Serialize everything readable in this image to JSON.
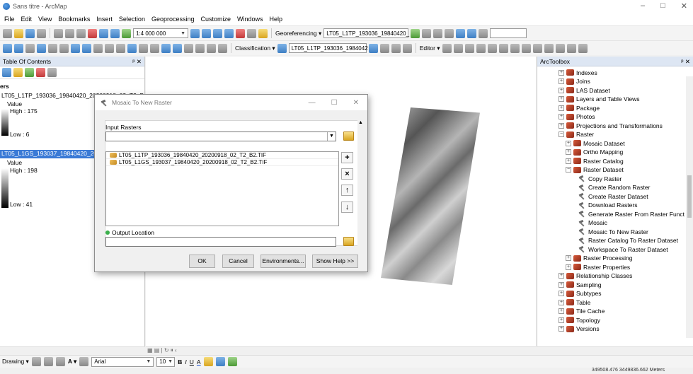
{
  "window": {
    "title": "Sans titre - ArcMap",
    "controls": [
      "–",
      "□",
      "✕"
    ]
  },
  "menu": [
    "File",
    "Edit",
    "View",
    "Bookmarks",
    "Insert",
    "Selection",
    "Geoprocessing",
    "Customize",
    "Windows",
    "Help"
  ],
  "toolbar1": {
    "scale": "1:4 000 000",
    "georef_label": "Georeferencing ▾",
    "georef_layer": "LT05_L1TP_193036_19840420_"
  },
  "toolbar2": {
    "classification_label": "Classification ▾",
    "layer": "LT05_L1TP_193036_1984042",
    "editor_label": "Editor ▾"
  },
  "toc": {
    "header": "Table Of Contents",
    "pin": "ᵖ ✕",
    "group": "ers",
    "layer1": {
      "name": "LT05_L1TP_193036_19840420_20200918_02_T2_B",
      "value_label": "Value",
      "high": "High : 175",
      "low": "Low : 6"
    },
    "layer2": {
      "name": "LT05_L1GS_193037_19840420_2020",
      "value_label": "Value",
      "high": "High : 198",
      "low": "Low : 41"
    }
  },
  "dialog": {
    "title": "Mosaic To New Raster",
    "input_label": "Input Rasters",
    "rasters": [
      "LT05_L1TP_193036_19840420_20200918_02_T2_B2.TIF",
      "LT05_L1GS_193037_19840420_20200918_02_T2_B2.TIF"
    ],
    "output_label": "Output Location",
    "buttons": {
      "ok": "OK",
      "cancel": "Cancel",
      "env": "Environments...",
      "help": "Show Help >>"
    },
    "side_buttons": [
      "+",
      "×",
      "↑",
      "↓"
    ]
  },
  "toolbox": {
    "header": "ArcToolbox",
    "pin": "ᵖ ✕",
    "items": [
      {
        "label": "Indexes",
        "level": 0,
        "expand": "+"
      },
      {
        "label": "Joins",
        "level": 0,
        "expand": "+"
      },
      {
        "label": "LAS Dataset",
        "level": 0,
        "expand": "+"
      },
      {
        "label": "Layers and Table Views",
        "level": 0,
        "expand": "+"
      },
      {
        "label": "Package",
        "level": 0,
        "expand": "+"
      },
      {
        "label": "Photos",
        "level": 0,
        "expand": "+"
      },
      {
        "label": "Projections and Transformations",
        "level": 0,
        "expand": "+"
      },
      {
        "label": "Raster",
        "level": 0,
        "expand": "−"
      },
      {
        "label": "Mosaic Dataset",
        "level": 1,
        "expand": "+"
      },
      {
        "label": "Ortho Mapping",
        "level": 1,
        "expand": "+"
      },
      {
        "label": "Raster Catalog",
        "level": 1,
        "expand": "+"
      },
      {
        "label": "Raster Dataset",
        "level": 1,
        "expand": "−"
      },
      {
        "label": "Copy Raster",
        "level": 2,
        "tool": true
      },
      {
        "label": "Create Random Raster",
        "level": 2,
        "tool": true
      },
      {
        "label": "Create Raster Dataset",
        "level": 2,
        "tool": true
      },
      {
        "label": "Download Rasters",
        "level": 2,
        "tool": true
      },
      {
        "label": "Generate Raster From Raster Funct",
        "level": 2,
        "tool": true
      },
      {
        "label": "Mosaic",
        "level": 2,
        "tool": true
      },
      {
        "label": "Mosaic To New Raster",
        "level": 2,
        "tool": true
      },
      {
        "label": "Raster Catalog To Raster Dataset",
        "level": 2,
        "tool": true
      },
      {
        "label": "Workspace To Raster Dataset",
        "level": 2,
        "tool": true
      },
      {
        "label": "Raster Processing",
        "level": 1,
        "expand": "+"
      },
      {
        "label": "Raster Properties",
        "level": 1,
        "expand": "+"
      },
      {
        "label": "Relationship Classes",
        "level": 0,
        "expand": "+"
      },
      {
        "label": "Sampling",
        "level": 0,
        "expand": "+"
      },
      {
        "label": "Subtypes",
        "level": 0,
        "expand": "+"
      },
      {
        "label": "Table",
        "level": 0,
        "expand": "+"
      },
      {
        "label": "Tile Cache",
        "level": 0,
        "expand": "+"
      },
      {
        "label": "Topology",
        "level": 0,
        "expand": "+"
      },
      {
        "label": "Versions",
        "level": 0,
        "expand": "+"
      }
    ]
  },
  "drawing": {
    "label": "Drawing ▾",
    "font": "Arial",
    "size": "10",
    "bold": "B",
    "italic": "I",
    "underline": "U",
    "font_color": "A"
  },
  "status": {
    "coordinates": "349508.476  3449836.662 Meters"
  }
}
